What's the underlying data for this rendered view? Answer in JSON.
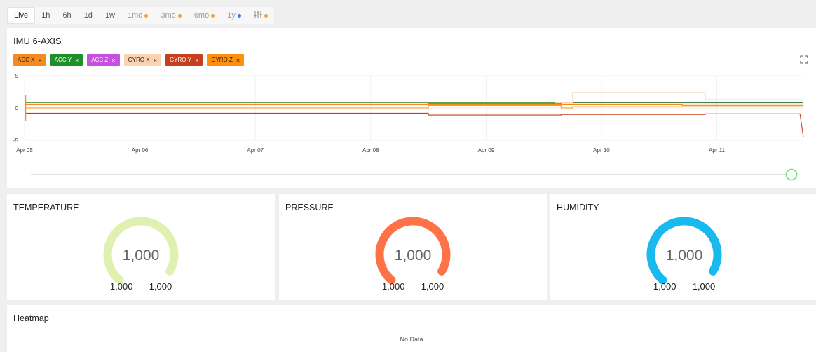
{
  "time_range": {
    "buttons": [
      {
        "label": "Live",
        "active": true,
        "dot": null
      },
      {
        "label": "1h",
        "active": false,
        "dot": null
      },
      {
        "label": "6h",
        "active": false,
        "dot": null
      },
      {
        "label": "1d",
        "active": false,
        "dot": null
      },
      {
        "label": "1w",
        "active": false,
        "dot": null
      },
      {
        "label": "1mo",
        "active": false,
        "dot": "#f5a031"
      },
      {
        "label": "3mo",
        "active": false,
        "dot": "#f5a031"
      },
      {
        "label": "6mo",
        "active": false,
        "dot": "#f5a031"
      },
      {
        "label": "1y",
        "active": false,
        "dot": "#2f7ef0"
      }
    ],
    "settings_icon": "sliders-icon",
    "settings_dot": "#f5a031"
  },
  "imu": {
    "title": "IMU 6-AXIS",
    "expand_icon": "expand-icon",
    "legend": [
      {
        "label": "ACC X",
        "bg": "#f58a1f",
        "fg": "#222222"
      },
      {
        "label": "ACC Y",
        "bg": "#1e9028",
        "fg": "#ffffff"
      },
      {
        "label": "ACC Z",
        "bg": "#c94fe0",
        "fg": "#ffffff"
      },
      {
        "label": "GYRO X",
        "bg": "#fcd3b0",
        "fg": "#222222"
      },
      {
        "label": "GYRO Y",
        "bg": "#c53f1c",
        "fg": "#ffffff"
      },
      {
        "label": "GYRO Z",
        "bg": "#ff8f0f",
        "fg": "#222222"
      }
    ]
  },
  "chart_data": {
    "type": "line",
    "title": "IMU 6-AXIS",
    "xlabel": "",
    "ylabel": "",
    "x_range": [
      "Apr 05 00:00",
      "Apr 11 18:00"
    ],
    "x_ticks": [
      "Apr 05",
      "Apr 06",
      "Apr 07",
      "Apr 08",
      "Apr 09",
      "Apr 10",
      "Apr 11"
    ],
    "ylim": [
      -5,
      5
    ],
    "y_ticks": [
      5,
      0,
      -5
    ],
    "grid": true,
    "series": [
      {
        "name": "ACC X",
        "color": "#f58a1f",
        "x": [
          0,
          3.5,
          3.5,
          4.65,
          4.65,
          5.7,
          5.7,
          6.75
        ],
        "y": [
          0.5,
          0.5,
          0.4,
          0.4,
          0.5,
          0.5,
          0.4,
          0.4
        ]
      },
      {
        "name": "ACC Y",
        "color": "#1e9028",
        "x": [
          0,
          6.75
        ],
        "y": [
          0.8,
          0.8
        ]
      },
      {
        "name": "ACC Z",
        "color": "#c94fe0",
        "x": [
          0,
          3.5,
          3.5,
          4.65,
          4.65,
          6.75
        ],
        "y": [
          0.9,
          0.9,
          0.7,
          0.7,
          0.9,
          0.9
        ]
      },
      {
        "name": "GYRO X",
        "color": "#fcd3b0",
        "x": [
          0,
          4.6,
          4.6,
          4.75,
          4.75,
          5.9,
          5.9,
          6.75
        ],
        "y": [
          0.9,
          0.9,
          0.8,
          0.8,
          2.4,
          2.4,
          1.3,
          1.3
        ]
      },
      {
        "name": "GYRO Y",
        "color": "#c53f1c",
        "x": [
          0,
          3.5,
          3.5,
          4.65,
          4.65,
          5.9,
          5.9,
          6.72,
          6.75
        ],
        "y": [
          -0.8,
          -0.8,
          -1.1,
          -1.1,
          -1.0,
          -1.0,
          -0.9,
          -0.9,
          -4.5
        ]
      },
      {
        "name": "GYRO Z",
        "color": "#ff8f0f",
        "x": [
          0,
          3.5,
          3.5,
          4.65,
          4.65,
          4.75,
          4.75,
          6.75
        ],
        "y": [
          0.0,
          0.0,
          0.5,
          0.5,
          0.0,
          0.0,
          0.2,
          0.2
        ]
      }
    ]
  },
  "gauges": [
    {
      "title": "TEMPERATURE",
      "value": "1,000",
      "min": "-1,000",
      "max": "1,000",
      "color": "#dff0b0",
      "fraction": 1.0
    },
    {
      "title": "PRESSURE",
      "value": "1,000",
      "min": "-1,000",
      "max": "1,000",
      "color": "#ff7146",
      "fraction": 1.0
    },
    {
      "title": "HUMIDITY",
      "value": "1,000",
      "min": "-1,000",
      "max": "1,000",
      "color": "#17b9ef",
      "fraction": 1.0
    }
  ],
  "heatmap": {
    "title": "Heatmap",
    "empty_text": "No Data"
  }
}
